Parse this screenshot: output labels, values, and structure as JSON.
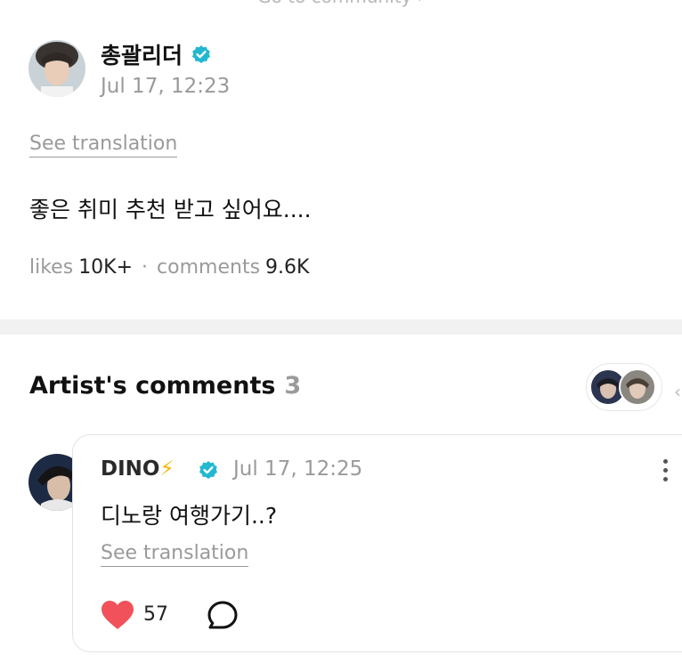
{
  "header": {
    "community_link": "Go to community ›"
  },
  "post": {
    "author": "총괄리더",
    "time": "Jul 17, 12:23",
    "translate_label": "See translation",
    "body": "좋은 취미 추천 받고 싶어요....",
    "likes_label": "likes",
    "likes_count": "10K+",
    "separator": "·",
    "comments_label": "comments",
    "comments_count": "9.6K"
  },
  "artist_comments": {
    "title": "Artist's comments",
    "count": "3"
  },
  "comment": {
    "author": "DINO",
    "author_emoji": "⚡",
    "time": "Jul 17, 12:25",
    "body": "디노랑 여행가기..?",
    "translate_label": "See translation",
    "like_count": "57"
  },
  "colors": {
    "verified": "#22b8cf",
    "heart": "#f0515a",
    "muted_text": "#9a9a9a",
    "divider": "#f1f1f1"
  },
  "icons": [
    "verified-badge-icon",
    "heart-icon",
    "reply-bubble-icon",
    "more-vertical-icon"
  ]
}
